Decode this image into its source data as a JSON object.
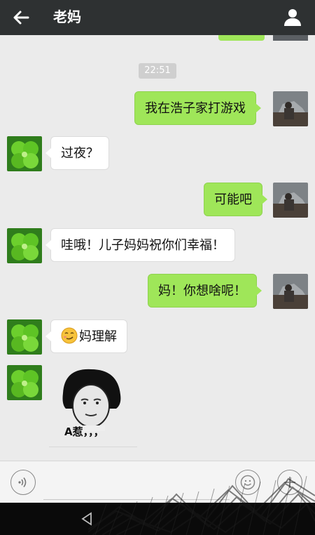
{
  "header": {
    "title": "老妈",
    "back_icon": "arrow-left-icon",
    "profile_icon": "person-icon"
  },
  "chat": {
    "timestamp": "22:51",
    "messages": [
      {
        "side": "out",
        "text": "我在浩子家打游戏"
      },
      {
        "side": "in",
        "text": "过夜？"
      },
      {
        "side": "out",
        "text": "可能吧"
      },
      {
        "side": "in",
        "text": "哇哦！儿子妈妈祝你们幸福！"
      },
      {
        "side": "out",
        "text": "妈！你想啥呢！"
      },
      {
        "side": "in",
        "text": "妈理解",
        "emoji": "smirk-face-icon"
      },
      {
        "side": "in",
        "sticker": "meme-face-sticker",
        "caption": "A惹，，，"
      }
    ]
  },
  "input_bar": {
    "voice_icon": "voice-icon",
    "input_value": "",
    "emoji_icon": "emoji-icon",
    "plus_icon": "plus-icon"
  },
  "colors": {
    "header_bg": "#2e3132",
    "chat_bg": "#ebebeb",
    "outgoing_bubble": "#9fe659",
    "incoming_bubble": "#ffffff"
  }
}
